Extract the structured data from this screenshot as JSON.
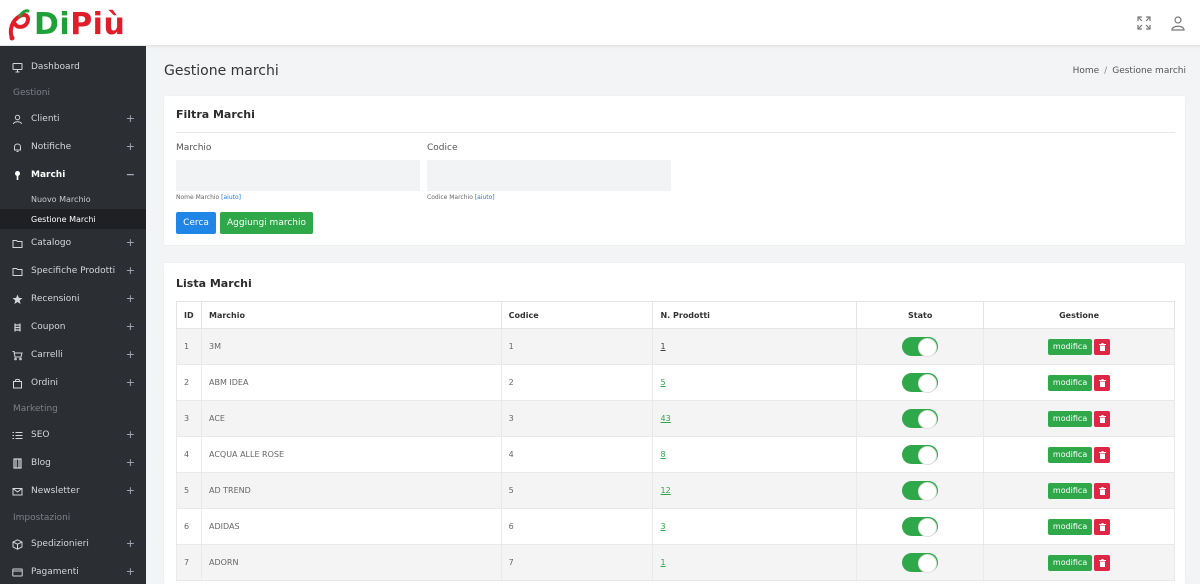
{
  "brand": {
    "name_part1": "Di",
    "name_part2": "Più",
    "accent_green": "#1fa13a",
    "accent_red": "#e11d2a"
  },
  "topbar": {
    "icons": [
      "fullscreen-icon",
      "user-icon"
    ]
  },
  "sidebar": {
    "items": [
      {
        "label": "Dashboard",
        "icon": "monitor-icon"
      },
      {
        "section": "Gestioni"
      },
      {
        "label": "Clienti",
        "icon": "user-icon",
        "toggle": "+"
      },
      {
        "label": "Notifiche",
        "icon": "bell-icon",
        "toggle": "+"
      },
      {
        "label": "Marchi",
        "icon": "tag-icon",
        "toggle": "−",
        "active": true
      },
      {
        "label": "Catalogo",
        "icon": "folder-icon",
        "toggle": "+"
      },
      {
        "label": "Specifiche Prodotti",
        "icon": "folder-icon",
        "toggle": "+"
      },
      {
        "label": "Recensioni",
        "icon": "star-icon",
        "toggle": "+"
      },
      {
        "label": "Coupon",
        "icon": "coupon-icon",
        "toggle": "+"
      },
      {
        "label": "Carrelli",
        "icon": "cart-icon",
        "toggle": "+"
      },
      {
        "label": "Ordini",
        "icon": "bag-icon",
        "toggle": "+"
      },
      {
        "section": "Marketing"
      },
      {
        "label": "SEO",
        "icon": "list-icon",
        "toggle": "+"
      },
      {
        "label": "Blog",
        "icon": "book-icon",
        "toggle": "+"
      },
      {
        "label": "Newsletter",
        "icon": "mail-icon",
        "toggle": "+"
      },
      {
        "section": "Impostazioni"
      },
      {
        "label": "Spedizionieri",
        "icon": "box-icon",
        "toggle": "+"
      },
      {
        "label": "Pagamenti",
        "icon": "card-icon",
        "toggle": "+"
      }
    ],
    "subitems": [
      "Nuovo Marchio",
      "Gestione Marchi"
    ]
  },
  "header": {
    "title": "Gestione marchi",
    "breadcrumb": [
      "Home",
      "Gestione marchi"
    ]
  },
  "filter": {
    "title": "Filtra Marchi",
    "marchio_label": "Marchio",
    "codice_label": "Codice",
    "marchio_value": "",
    "codice_value": "",
    "marchio_hint": "Nome Marchio",
    "codice_hint": "Codice Marchio",
    "hint_link": "[aiuto]",
    "search_button": "Cerca",
    "add_button": "Aggiungi marchio"
  },
  "list": {
    "title": "Lista Marchi",
    "columns": [
      "ID",
      "Marchio",
      "Codice",
      "N. Prodotti",
      "Stato",
      "Gestione"
    ],
    "edit_label": "modifica",
    "rows": [
      {
        "id": "1",
        "name": "3M",
        "code": "1",
        "count": "1",
        "active": true
      },
      {
        "id": "2",
        "name": "ABM IDEA",
        "code": "2",
        "count": "5",
        "active": true
      },
      {
        "id": "3",
        "name": "ACE",
        "code": "3",
        "count": "43",
        "active": true
      },
      {
        "id": "4",
        "name": "ACQUA ALLE ROSE",
        "code": "4",
        "count": "8",
        "active": true
      },
      {
        "id": "5",
        "name": "AD TREND",
        "code": "5",
        "count": "12",
        "active": true
      },
      {
        "id": "6",
        "name": "ADIDAS",
        "code": "6",
        "count": "3",
        "active": true
      },
      {
        "id": "7",
        "name": "ADORN",
        "code": "7",
        "count": "1",
        "active": true
      }
    ]
  }
}
